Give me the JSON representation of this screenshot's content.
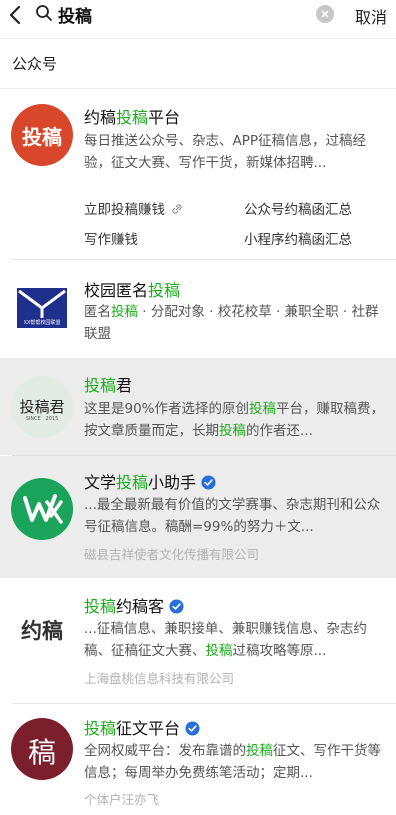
{
  "search": {
    "query": "投稿",
    "cancel_label": "取消"
  },
  "section": {
    "title": "公众号"
  },
  "results": [
    {
      "avatar_text": "投稿",
      "title_pre": "约稿",
      "title_hl": "投稿",
      "title_post": "平台",
      "description": "每日推送公众号、杂志、APP征稿信息，过稿经验，征文大赛、写作干货，新媒体招聘...",
      "links": [
        "立即投稿赚钱",
        "公众号约稿函汇总",
        "写作赚钱",
        "小程序约稿函汇总"
      ]
    },
    {
      "avatar_badge": "XX帮帮校园联盟",
      "title_pre": "校园匿名",
      "title_hl": "投稿",
      "title_post": "",
      "desc_1": "匿名",
      "desc_hl": "投稿",
      "desc_2": " · 分配对象 · 校花校草 · 兼职全职 · 社群联盟"
    },
    {
      "avatar_text": "投稿君",
      "avatar_sub": "SINCE   2015",
      "title_hl": "投稿",
      "title_post": "君",
      "desc_1": "这里是90%作者选择的原创",
      "desc_hl": "投稿",
      "desc_2": "平台，赚取稿费，按文章质量而定，长期",
      "desc_hl2": "投稿",
      "desc_3": "的作者还..."
    },
    {
      "title_pre": "文学",
      "title_hl": "投稿",
      "title_post": "小助手",
      "description": "...最全最新最有价值的文学赛事、杂志期刊和公众号征稿信息。稿酬=99%的努力＋文...",
      "owner": "磁县吉祥使者文化传播有限公司"
    },
    {
      "avatar_text": "约稿",
      "title_hl": "投稿",
      "title_post": "约稿客",
      "desc_1": "...征稿信息、兼职接单、兼职赚钱信息、杂志约稿、征稿征文大赛、",
      "desc_hl": "投稿",
      "desc_2": "过稿攻略等原...",
      "owner": "上海盘桃信息科技有限公司"
    },
    {
      "avatar_text": "稿",
      "title_hl": "投稿",
      "title_post": "征文平台",
      "desc_1": "全网权威平台：发布靠谱的",
      "desc_hl": "投稿",
      "desc_2": "征文、写作干货等信息；每周举办免费练笔活动；定期...",
      "owner": "个体户汪亦飞"
    }
  ],
  "colors": {
    "highlight": "#1aad19",
    "avatar1_bg": "#d8472b",
    "avatar2_bg": "#1f2f8c",
    "avatar4_bg": "#1aa35a",
    "avatar6_bg": "#7a1f2b",
    "verified": "#2a6ed8"
  }
}
